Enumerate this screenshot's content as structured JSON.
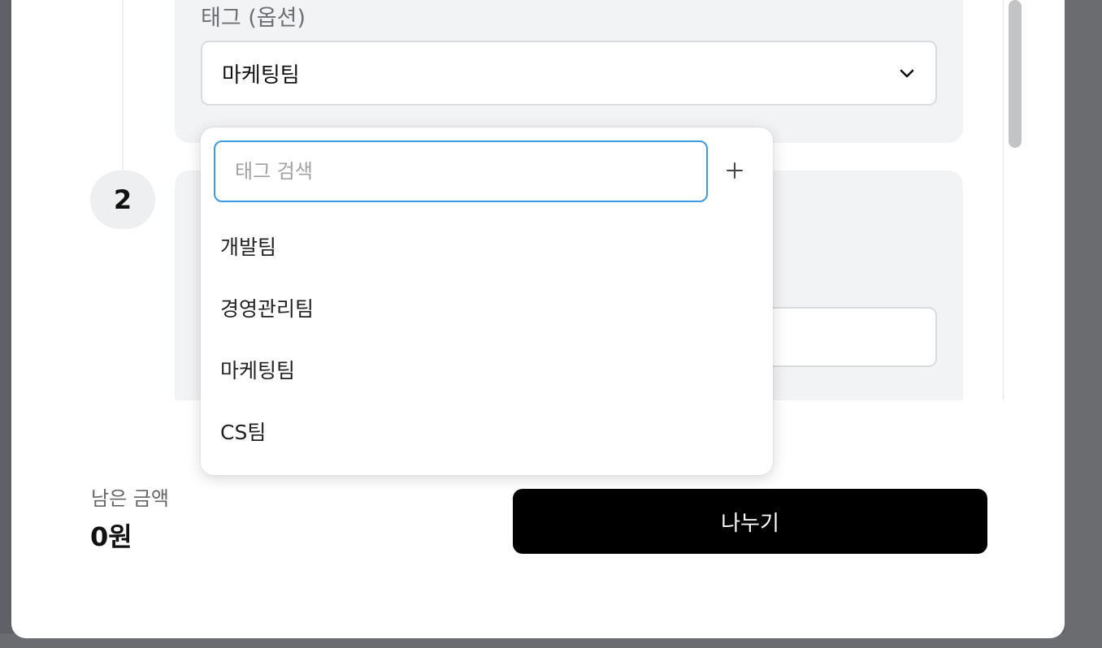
{
  "tag_section": {
    "label": "태그 (옵션)",
    "selected_value": "마케팅팀"
  },
  "step": {
    "number": "2"
  },
  "tag_dropdown": {
    "search_placeholder": "태그 검색",
    "add_icon": "plus-icon",
    "options": [
      {
        "label": "개발팀"
      },
      {
        "label": "경영관리팀"
      },
      {
        "label": "마케팅팀"
      },
      {
        "label": "CS팀"
      }
    ]
  },
  "footer": {
    "remaining_label": "남은 금액",
    "remaining_value": "0원",
    "split_button": "나누기"
  },
  "colors": {
    "focus_border": "#3b9be4",
    "primary_button": "#000000",
    "card_background": "#f2f3f5"
  }
}
